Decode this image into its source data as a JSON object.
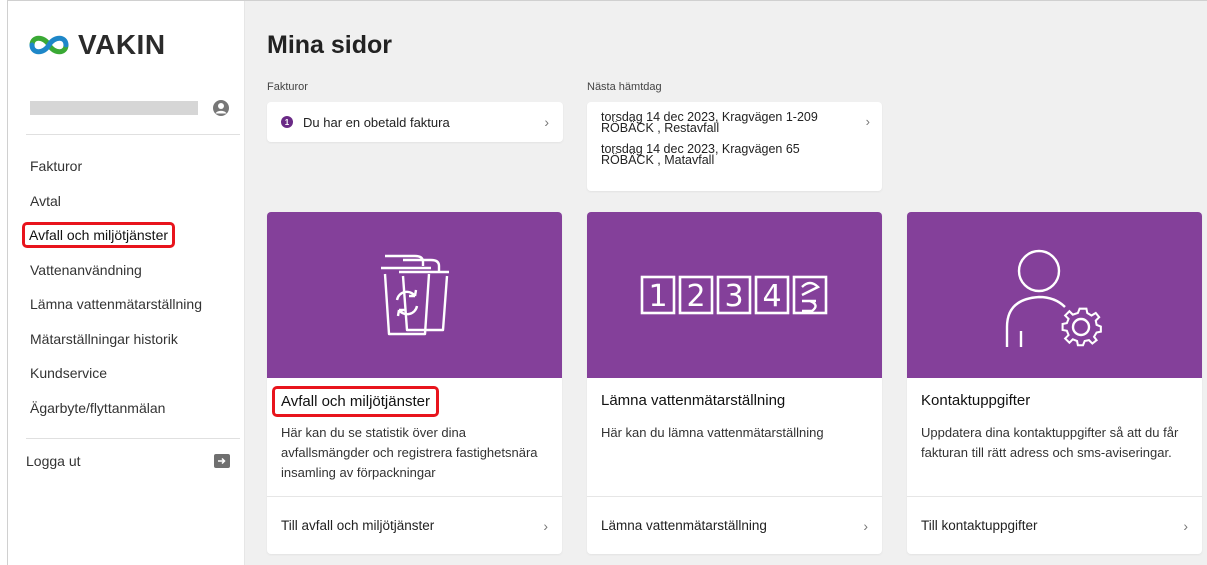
{
  "brand": {
    "name": "VAKIN",
    "accent": "#84409a",
    "logo_colors": [
      "#1e87c8",
      "#3aa935"
    ]
  },
  "sidebar": {
    "user_icon": "account-circle-icon",
    "items": [
      {
        "label": "Fakturor"
      },
      {
        "label": "Avtal"
      },
      {
        "label": "Avfall och miljötjänster"
      },
      {
        "label": "Vattenanvändning"
      },
      {
        "label": "Lämna vattenmätarställning"
      },
      {
        "label": "Mätarställningar historik"
      },
      {
        "label": "Kundservice"
      },
      {
        "label": "Ägarbyte/flyttanmälan"
      }
    ],
    "logout_label": "Logga ut",
    "logout_icon": "logout-icon"
  },
  "main": {
    "title": "Mina sidor",
    "invoices": {
      "label": "Fakturor",
      "badge": "1",
      "text": "Du har en obetald faktura"
    },
    "pickup": {
      "label": "Nästa hämtdag",
      "items": [
        {
          "text": "torsdag 14 dec 2023, Kragvägen 1-209 RÖBÄCK , Restavfall"
        },
        {
          "text": "torsdag 14 dec 2023, Kragvägen 65 RÖBÄCK , Matavfall"
        }
      ]
    },
    "tiles": [
      {
        "icon": "waste-bins-icon",
        "title": "Avfall och miljötjänster",
        "desc": "Här kan du se statistik över dina avfallsmängder och registrera fastighetsnära insamling av förpackningar",
        "link": "Till avfall och miljötjänster"
      },
      {
        "icon": "meter-digits-icon",
        "digits": [
          "1",
          "2",
          "3",
          "4"
        ],
        "title": "Lämna vattenmätarställning",
        "desc": "Här kan du lämna vattenmätarställning",
        "link": "Lämna vattenmätarställning"
      },
      {
        "icon": "user-settings-icon",
        "title": "Kontaktuppgifter",
        "desc": "Uppdatera dina kontaktuppgifter så att du får fakturan till rätt adress och sms-aviseringar.",
        "link": "Till kontaktuppgifter"
      }
    ]
  }
}
